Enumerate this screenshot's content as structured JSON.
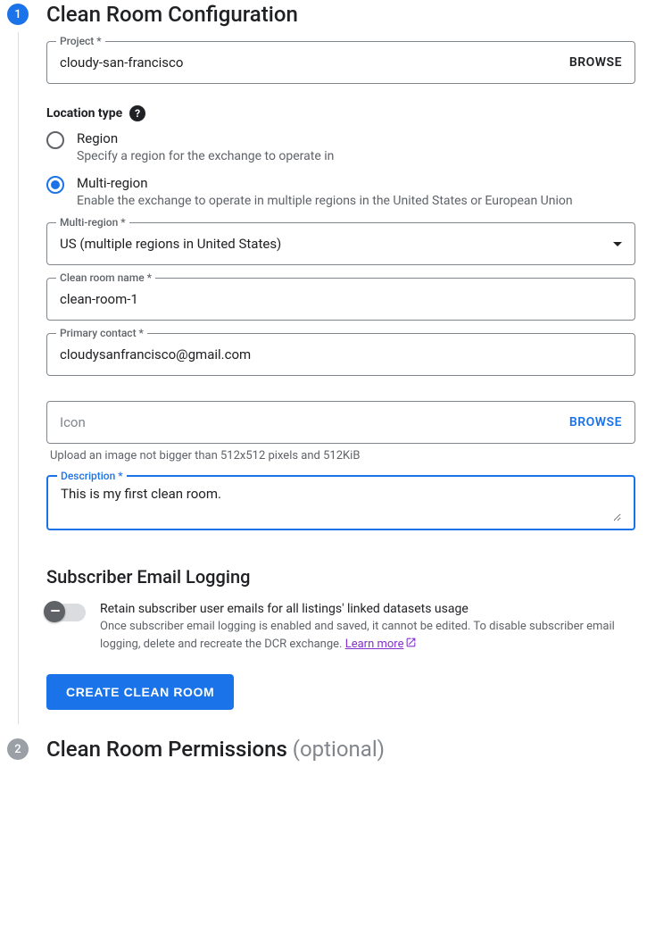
{
  "step1": {
    "number": "1",
    "title": "Clean Room Configuration",
    "project": {
      "label": "Project *",
      "value": "cloudy-san-francisco",
      "action": "Browse"
    },
    "location_type_label": "Location type",
    "radios": [
      {
        "label": "Region",
        "desc": "Specify a region for the exchange to operate in",
        "checked": false
      },
      {
        "label": "Multi-region",
        "desc": "Enable the exchange to operate in multiple regions in the United States or European Union",
        "checked": true
      }
    ],
    "multi_region": {
      "label": "Multi-region *",
      "value": "US (multiple regions in United States)"
    },
    "clean_room_name": {
      "label": "Clean room name *",
      "value": "clean-room-1"
    },
    "primary_contact": {
      "label": "Primary contact *",
      "value": "cloudysanfrancisco@gmail.com"
    },
    "icon_field": {
      "placeholder": "Icon",
      "action": "Browse",
      "helper": "Upload an image not bigger than 512x512 pixels and 512KiB"
    },
    "description": {
      "label": "Description *",
      "value": "This is my first clean room."
    },
    "sub_email_heading": "Subscriber Email Logging",
    "toggle": {
      "label": "Retain subscriber user emails for all listings' linked datasets usage",
      "desc": "Once subscriber email logging is enabled and saved, it cannot be edited. To disable subscriber email logging, delete and recreate the DCR exchange. ",
      "link": "Learn more"
    },
    "create_btn": "Create Clean Room"
  },
  "step2": {
    "number": "2",
    "title": "Clean Room Permissions",
    "optional": "(optional)"
  }
}
